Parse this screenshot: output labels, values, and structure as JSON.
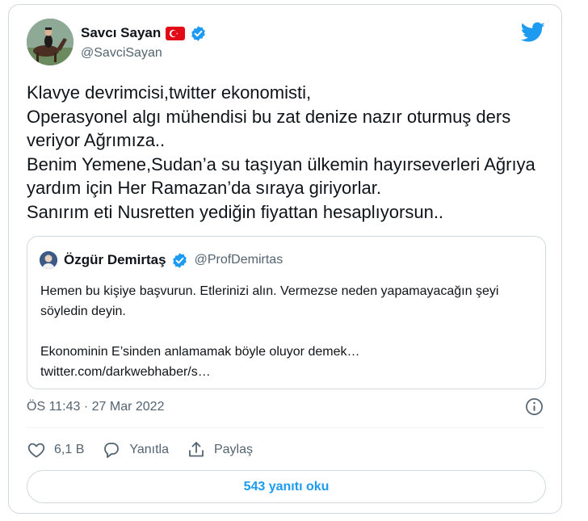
{
  "author": {
    "name": "Savcı Sayan",
    "handle": "@SavciSayan"
  },
  "tweet": {
    "text": "Klavye devrimcisi,twitter ekonomisti,\nOperasyonel algı mühendisi bu zat denize nazır oturmuş ders veriyor Ağrımıza..\nBenim Yemene,Sudan’a su taşıyan ülkemin hayırseverleri Ağrıya yardım için Her Ramazan’da sıraya giriyorlar.\nSanırım eti Nusretten yediğin fiyattan hesaplıyorsun.."
  },
  "quoted": {
    "name": "Özgür Demirtaş",
    "handle": "@ProfDemirtas",
    "line1": "Hemen bu kişiye başvurun. Etlerinizi alın. Vermezse neden yapamayacağın şeyi söyledin deyin.",
    "line2": "Ekonominin E’sinden anlamamak böyle oluyor demek…",
    "link": "twitter.com/darkwebhaber/s…"
  },
  "meta": {
    "timestamp": "ÖS 11:43 · 27 Mar 2022"
  },
  "actions": {
    "like_count": "6,1 B",
    "reply_label": "Yanıtla",
    "share_label": "Paylaş"
  },
  "replies_button": "543 yanıtı oku",
  "colors": {
    "accent": "#1d9bf0",
    "text_primary": "#0f1419",
    "text_secondary": "#536471",
    "border": "#cfd9de",
    "flag_red": "#e30a17"
  },
  "icons": {
    "verified": "verified-badge-icon",
    "flag": "turkey-flag-icon",
    "logo": "twitter-bird-icon",
    "info": "info-icon",
    "like": "heart-icon",
    "reply": "speech-bubble-icon",
    "share": "share-upload-icon"
  }
}
